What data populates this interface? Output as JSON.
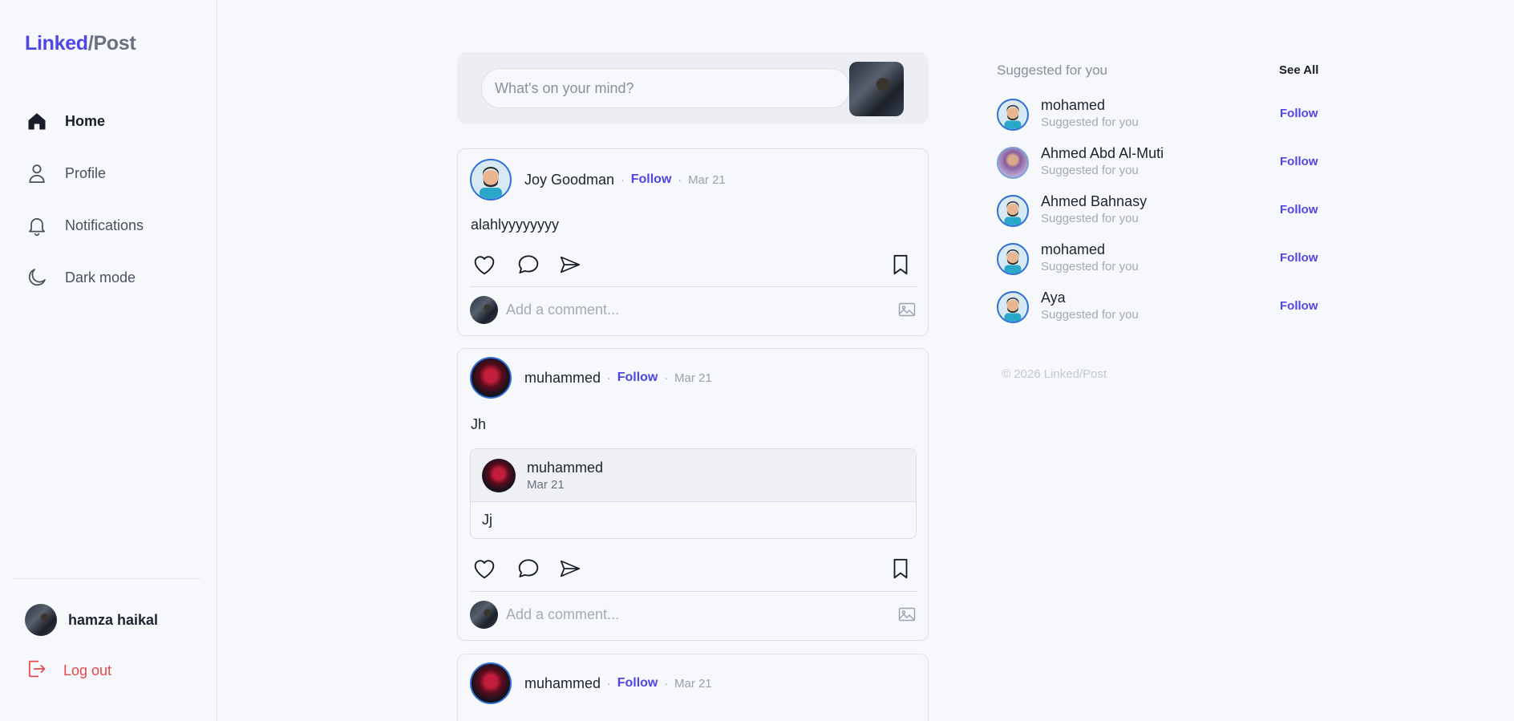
{
  "brand": {
    "part1": "Linked",
    "separator": "/",
    "part2": "Post",
    "accent": "#4f46e5"
  },
  "nav": {
    "items": [
      {
        "label": "Home",
        "icon": "home-icon",
        "active": true
      },
      {
        "label": "Profile",
        "icon": "user-icon",
        "active": false
      },
      {
        "label": "Notifications",
        "icon": "bell-icon",
        "active": false
      },
      {
        "label": "Dark mode",
        "icon": "moon-icon",
        "active": false
      }
    ]
  },
  "current_user": {
    "name": "hamza haikal"
  },
  "logout": {
    "label": "Log out",
    "color": "#e5484d"
  },
  "composer": {
    "placeholder": "What's on your mind?"
  },
  "posts": [
    {
      "author": "Joy Goodman",
      "follow": "Follow",
      "separator": "·",
      "date": "Mar 21",
      "text": "alahlyyyyyyyy",
      "comment_placeholder": "Add a comment..."
    },
    {
      "author": "muhammed",
      "follow": "Follow",
      "separator": "·",
      "date": "Mar 21",
      "text": "Jh",
      "shared": {
        "author": "muhammed",
        "date": "Mar 21",
        "text": "Jj"
      },
      "comment_placeholder": "Add a comment..."
    },
    {
      "author": "muhammed",
      "follow": "Follow",
      "separator": "·",
      "date": "Mar 21"
    }
  ],
  "suggestions": {
    "title": "Suggested for you",
    "see_all": "See All",
    "items": [
      {
        "name": "mohamed",
        "subtitle": "Suggested for you",
        "action": "Follow"
      },
      {
        "name": "Ahmed Abd Al-Muti",
        "subtitle": "Suggested for you",
        "action": "Follow"
      },
      {
        "name": "Ahmed Bahnasy",
        "subtitle": "Suggested for you",
        "action": "Follow"
      },
      {
        "name": "mohamed",
        "subtitle": "Suggested for you",
        "action": "Follow"
      },
      {
        "name": "Aya",
        "subtitle": "Suggested for you",
        "action": "Follow"
      }
    ]
  },
  "footer": {
    "copyright": "© 2026 Linked/Post"
  }
}
